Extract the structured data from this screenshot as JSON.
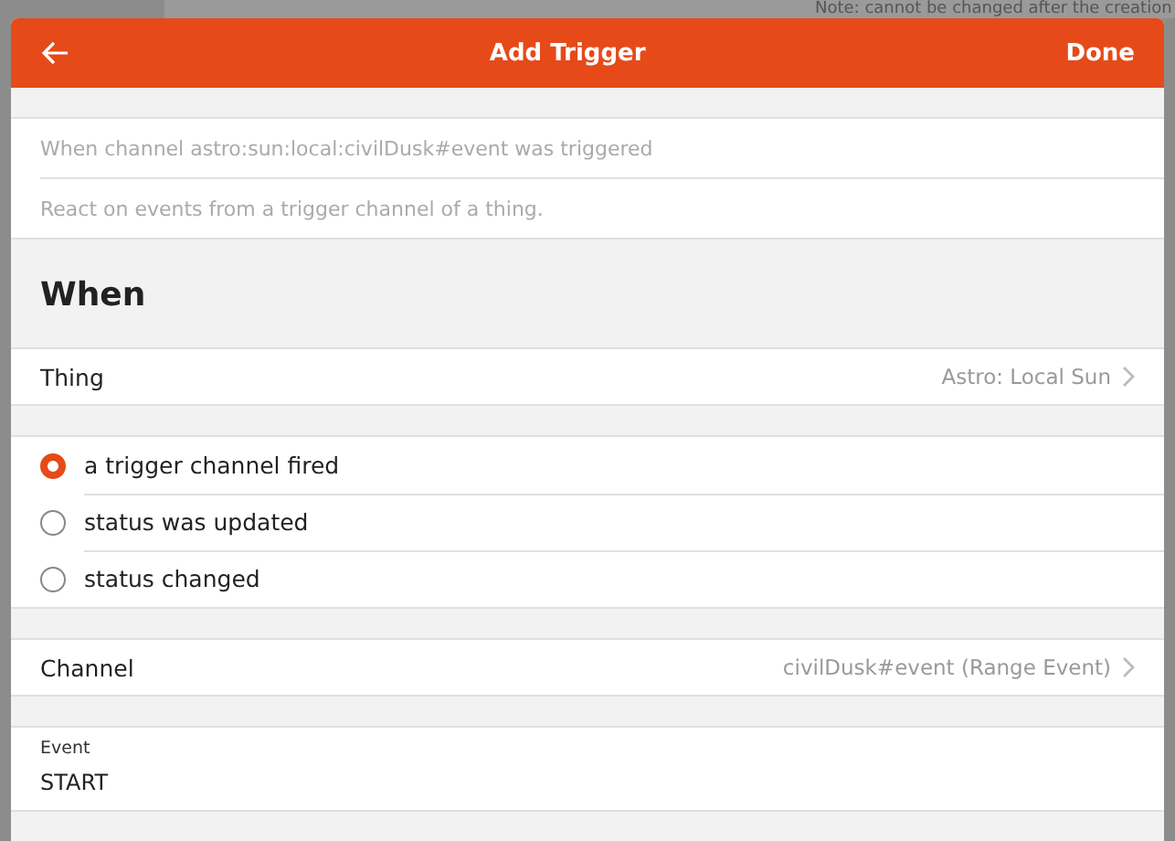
{
  "background": {
    "note": "Note: cannot be changed after the creation"
  },
  "header": {
    "title": "Add Trigger",
    "done": "Done"
  },
  "summary": [
    "When channel astro:sun:local:civilDusk#event was triggered",
    "React on events from a trigger channel of a thing."
  ],
  "section_title": "When",
  "thing": {
    "label": "Thing",
    "value": "Astro: Local Sun"
  },
  "trigger_types": [
    {
      "label": "a trigger channel fired",
      "selected": true
    },
    {
      "label": "status was updated",
      "selected": false
    },
    {
      "label": "status changed",
      "selected": false
    }
  ],
  "channel": {
    "label": "Channel",
    "value": "civilDusk#event (Range Event)"
  },
  "event": {
    "label": "Event",
    "value": "START"
  }
}
